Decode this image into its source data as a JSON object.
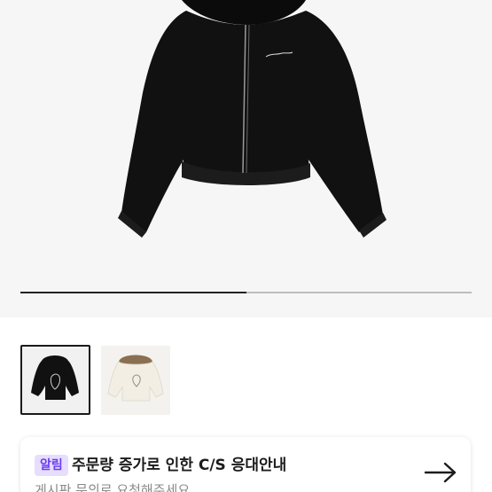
{
  "gallery": {
    "progress_fraction": 0.5,
    "thumbnails": [
      {
        "name": "black-jacket-back",
        "selected": true
      },
      {
        "name": "white-jacket-back",
        "selected": false
      }
    ]
  },
  "notice": {
    "badge": "알림",
    "title": "주문량 증가로 인한 C/S 응대안내",
    "subtitle": "게시판 문의로 요청해주세요",
    "arrow_icon": "arrow-right-icon"
  },
  "colors": {
    "badge_bg": "#e6ddff",
    "badge_text": "#6b3cf0",
    "progress_active": "#222222"
  }
}
